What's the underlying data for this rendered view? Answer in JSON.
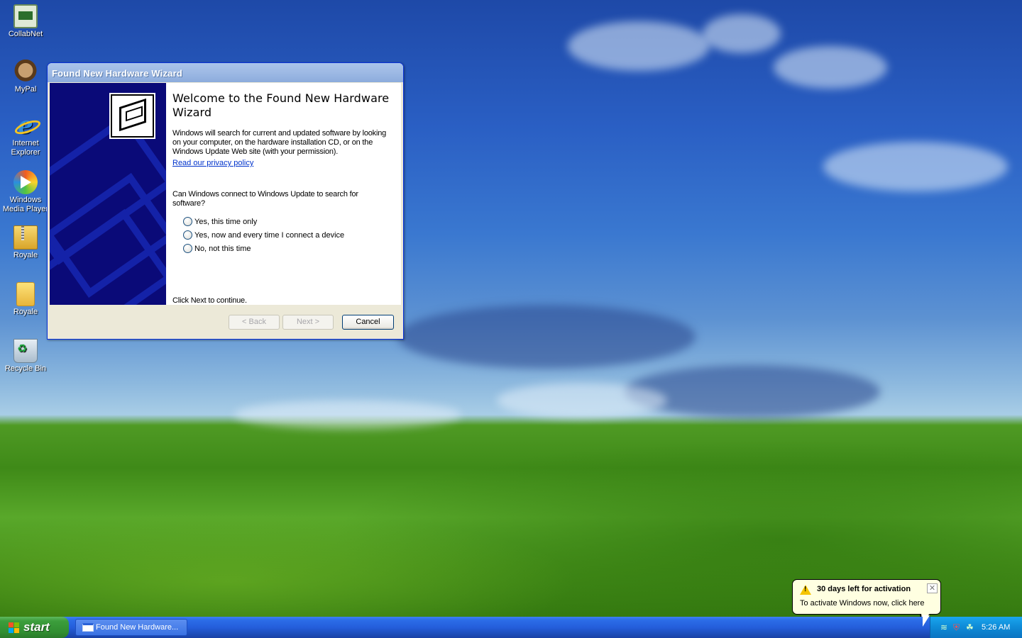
{
  "desktop": {
    "icons": [
      {
        "label": "CollabNet",
        "icon": "collabnet-icon"
      },
      {
        "label": "MyPal",
        "icon": "mypal-browser-icon"
      },
      {
        "label": "Internet Explorer",
        "icon": "internet-explorer-icon"
      },
      {
        "label": "Windows Media Player",
        "icon": "windows-media-player-icon"
      },
      {
        "label": "Royale",
        "icon": "zip-folder-icon"
      },
      {
        "label": "Royale",
        "icon": "folder-icon"
      },
      {
        "label": "Recycle Bin",
        "icon": "recycle-bin-icon"
      }
    ]
  },
  "wizard": {
    "window_title": "Found New Hardware Wizard",
    "heading": "Welcome to the Found New Hardware Wizard",
    "description": "Windows will search for current and updated software by looking on your computer, on the hardware installation CD, or on the Windows Update Web site (with your permission).",
    "privacy_link": "Read our privacy policy",
    "question": "Can Windows connect to Windows Update to search for software?",
    "options": [
      {
        "label": "Yes, this time only",
        "selected": false
      },
      {
        "label": "Yes, now and every time I connect a device",
        "selected": false
      },
      {
        "label": "No, not this time",
        "selected": false
      }
    ],
    "continue_text": "Click Next to continue.",
    "buttons": {
      "back": "< Back",
      "next": "Next >",
      "cancel": "Cancel"
    },
    "side_color": "#0a0a78"
  },
  "taskbar": {
    "start_label": "start",
    "task_item": "Found New Hardware...",
    "clock": "5:26 AM",
    "tray_icons": [
      "network-icon",
      "security-shield-icon",
      "antivirus-icon"
    ],
    "color": "#245edb"
  },
  "balloon": {
    "title": "30 days left for activation",
    "text": "To activate Windows now, click here",
    "icon": "warning-icon"
  }
}
